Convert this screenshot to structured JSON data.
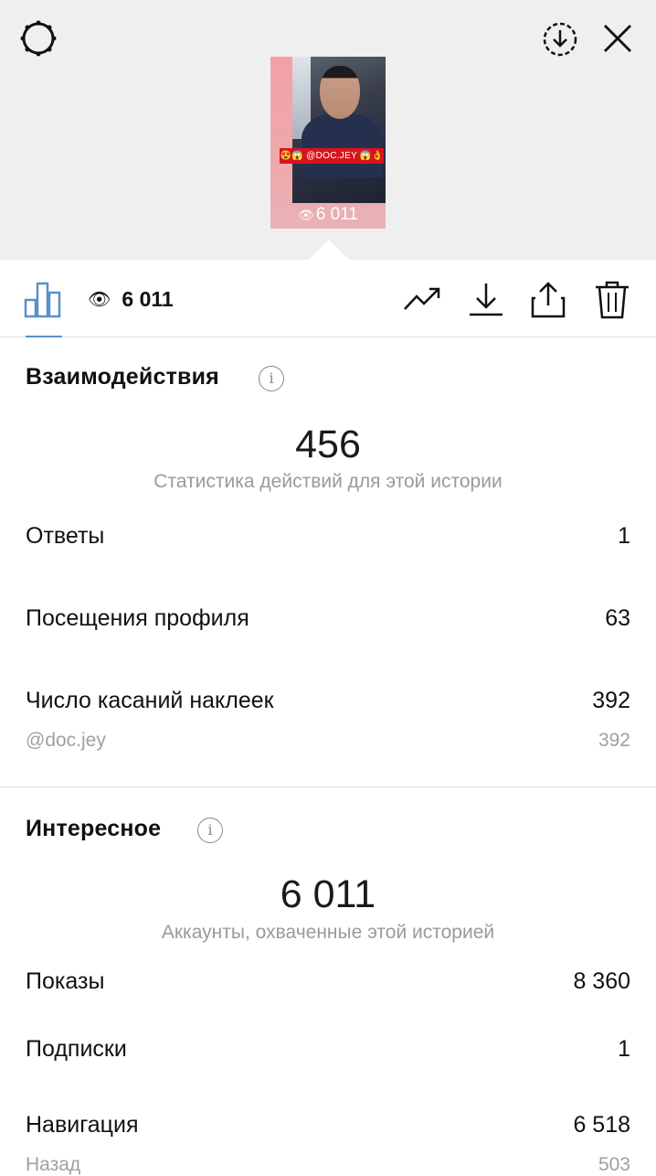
{
  "story": {
    "sticker_text": "😍😱 @DOC.JEY 😱👌",
    "views": "6 011"
  },
  "toolbar": {
    "views": "6 011"
  },
  "interactions": {
    "title": "Взаимодействия",
    "total": "456",
    "caption": "Статистика действий для этой истории",
    "rows": [
      {
        "label": "Ответы",
        "value": "1"
      },
      {
        "label": "Посещения профиля",
        "value": "63"
      },
      {
        "label": "Число касаний наклеек",
        "value": "392"
      }
    ],
    "sub_rows": [
      {
        "label": "@doc.jey",
        "value": "392"
      }
    ]
  },
  "discovery": {
    "title": "Интересное",
    "total": "6 011",
    "caption": "Аккаунты, охваченные этой историей",
    "rows": [
      {
        "label": "Показы",
        "value": "8 360"
      },
      {
        "label": "Подписки",
        "value": "1"
      },
      {
        "label": "Навигация",
        "value": "6 518"
      }
    ],
    "sub_rows": [
      {
        "label": "Назад",
        "value": "503"
      }
    ]
  },
  "colors": {
    "accent": "#5a8fd0",
    "top_background": "#efefef",
    "secondary_text": "#9a9a9a"
  },
  "icons": [
    "settings-icon",
    "save-story-icon",
    "close-icon",
    "insights-bar-chart-icon",
    "eye-icon",
    "promote-trend-icon",
    "download-icon",
    "share-icon",
    "trash-icon",
    "info-icon"
  ]
}
